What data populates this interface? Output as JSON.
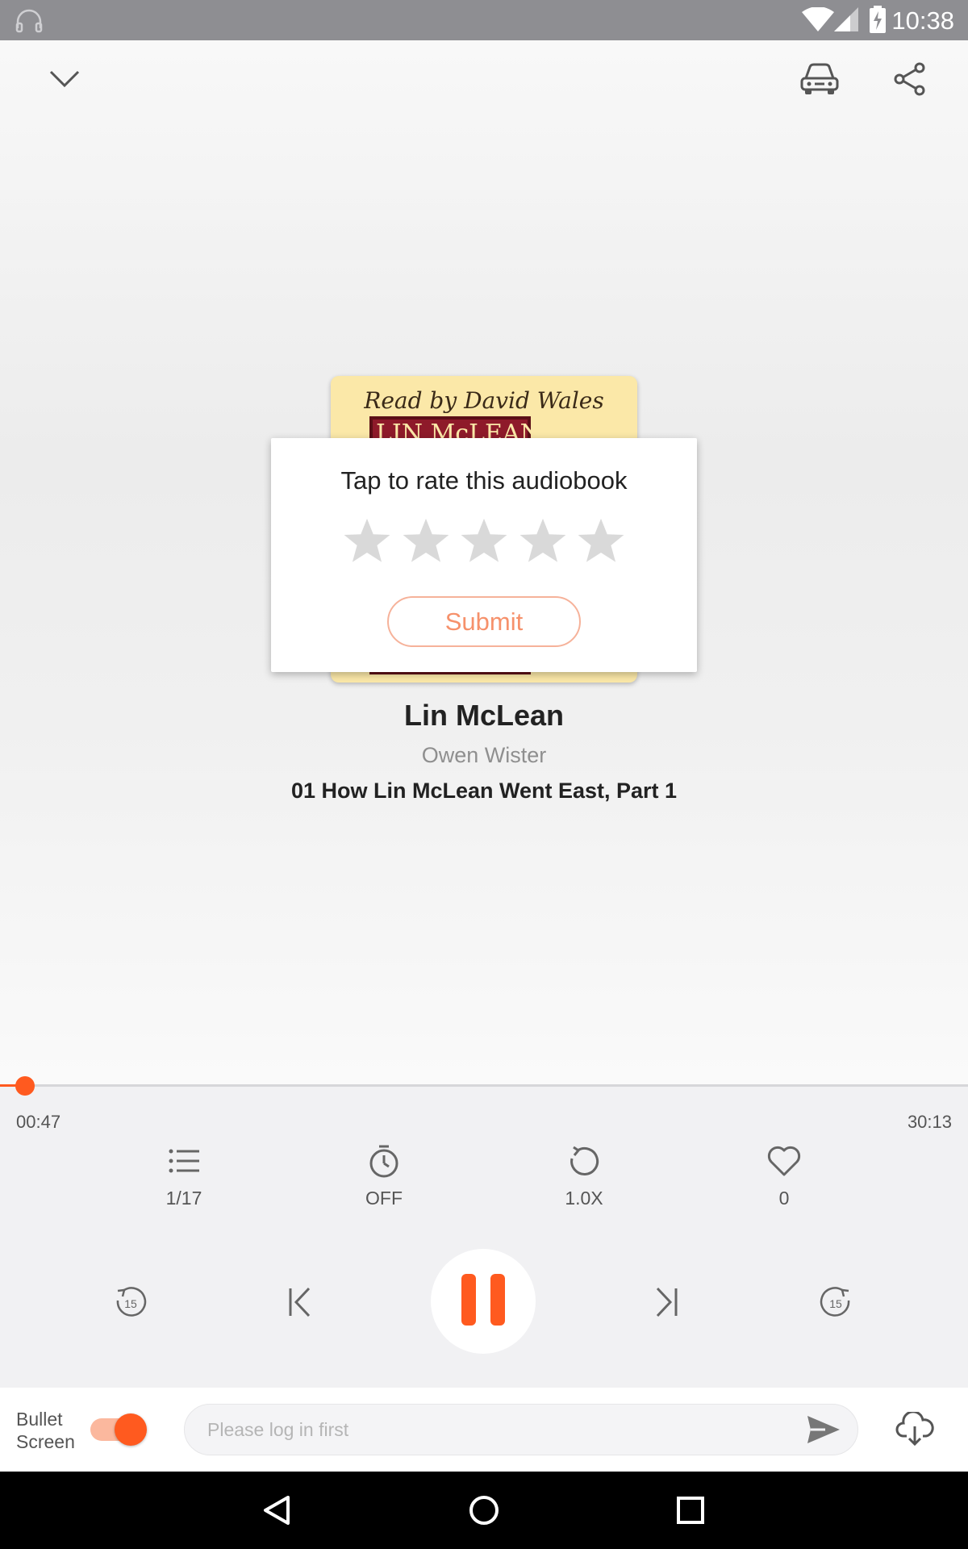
{
  "status_bar": {
    "time": "10:38",
    "icons": [
      "headphones-icon",
      "wifi-icon",
      "cell-signal-icon",
      "battery-charging-icon"
    ]
  },
  "header": {
    "collapse_icon": "chevron-down-icon",
    "car_mode_icon": "car-icon",
    "share_icon": "share-icon"
  },
  "cover": {
    "read_by": "Read by David Wales",
    "title": "LIN McLEAN"
  },
  "rating_dialog": {
    "title": "Tap to rate this audiobook",
    "stars_total": 5,
    "stars_selected": 0,
    "submit_label": "Submit"
  },
  "book": {
    "title": "Lin McLean",
    "author": "Owen Wister",
    "chapter": "01 How Lin McLean Went East, Part 1"
  },
  "progress": {
    "current": "00:47",
    "total": "30:13",
    "fraction": 0.026
  },
  "tools": [
    {
      "icon": "playlist-icon",
      "label": "1/17"
    },
    {
      "icon": "timer-icon",
      "label": "OFF"
    },
    {
      "icon": "speed-icon",
      "label": "1.0X"
    },
    {
      "icon": "heart-icon",
      "label": "0"
    }
  ],
  "playback": {
    "rewind_icon": "rewind-15-icon",
    "rewind_label": "15",
    "previous_icon": "skip-previous-icon",
    "pause_icon": "pause-icon",
    "next_icon": "skip-next-icon",
    "forward_icon": "forward-15-icon",
    "forward_label": "15"
  },
  "bottom_bar": {
    "bullet_label_line1": "Bullet",
    "bullet_label_line2": "Screen",
    "bullet_on": true,
    "input_placeholder": "Please log in first",
    "send_icon": "send-icon",
    "download_icon": "download-icon"
  },
  "colors": {
    "accent": "#ff5a1f",
    "accent_light": "#fbb89e",
    "star_inactive": "#d9d9d9"
  }
}
